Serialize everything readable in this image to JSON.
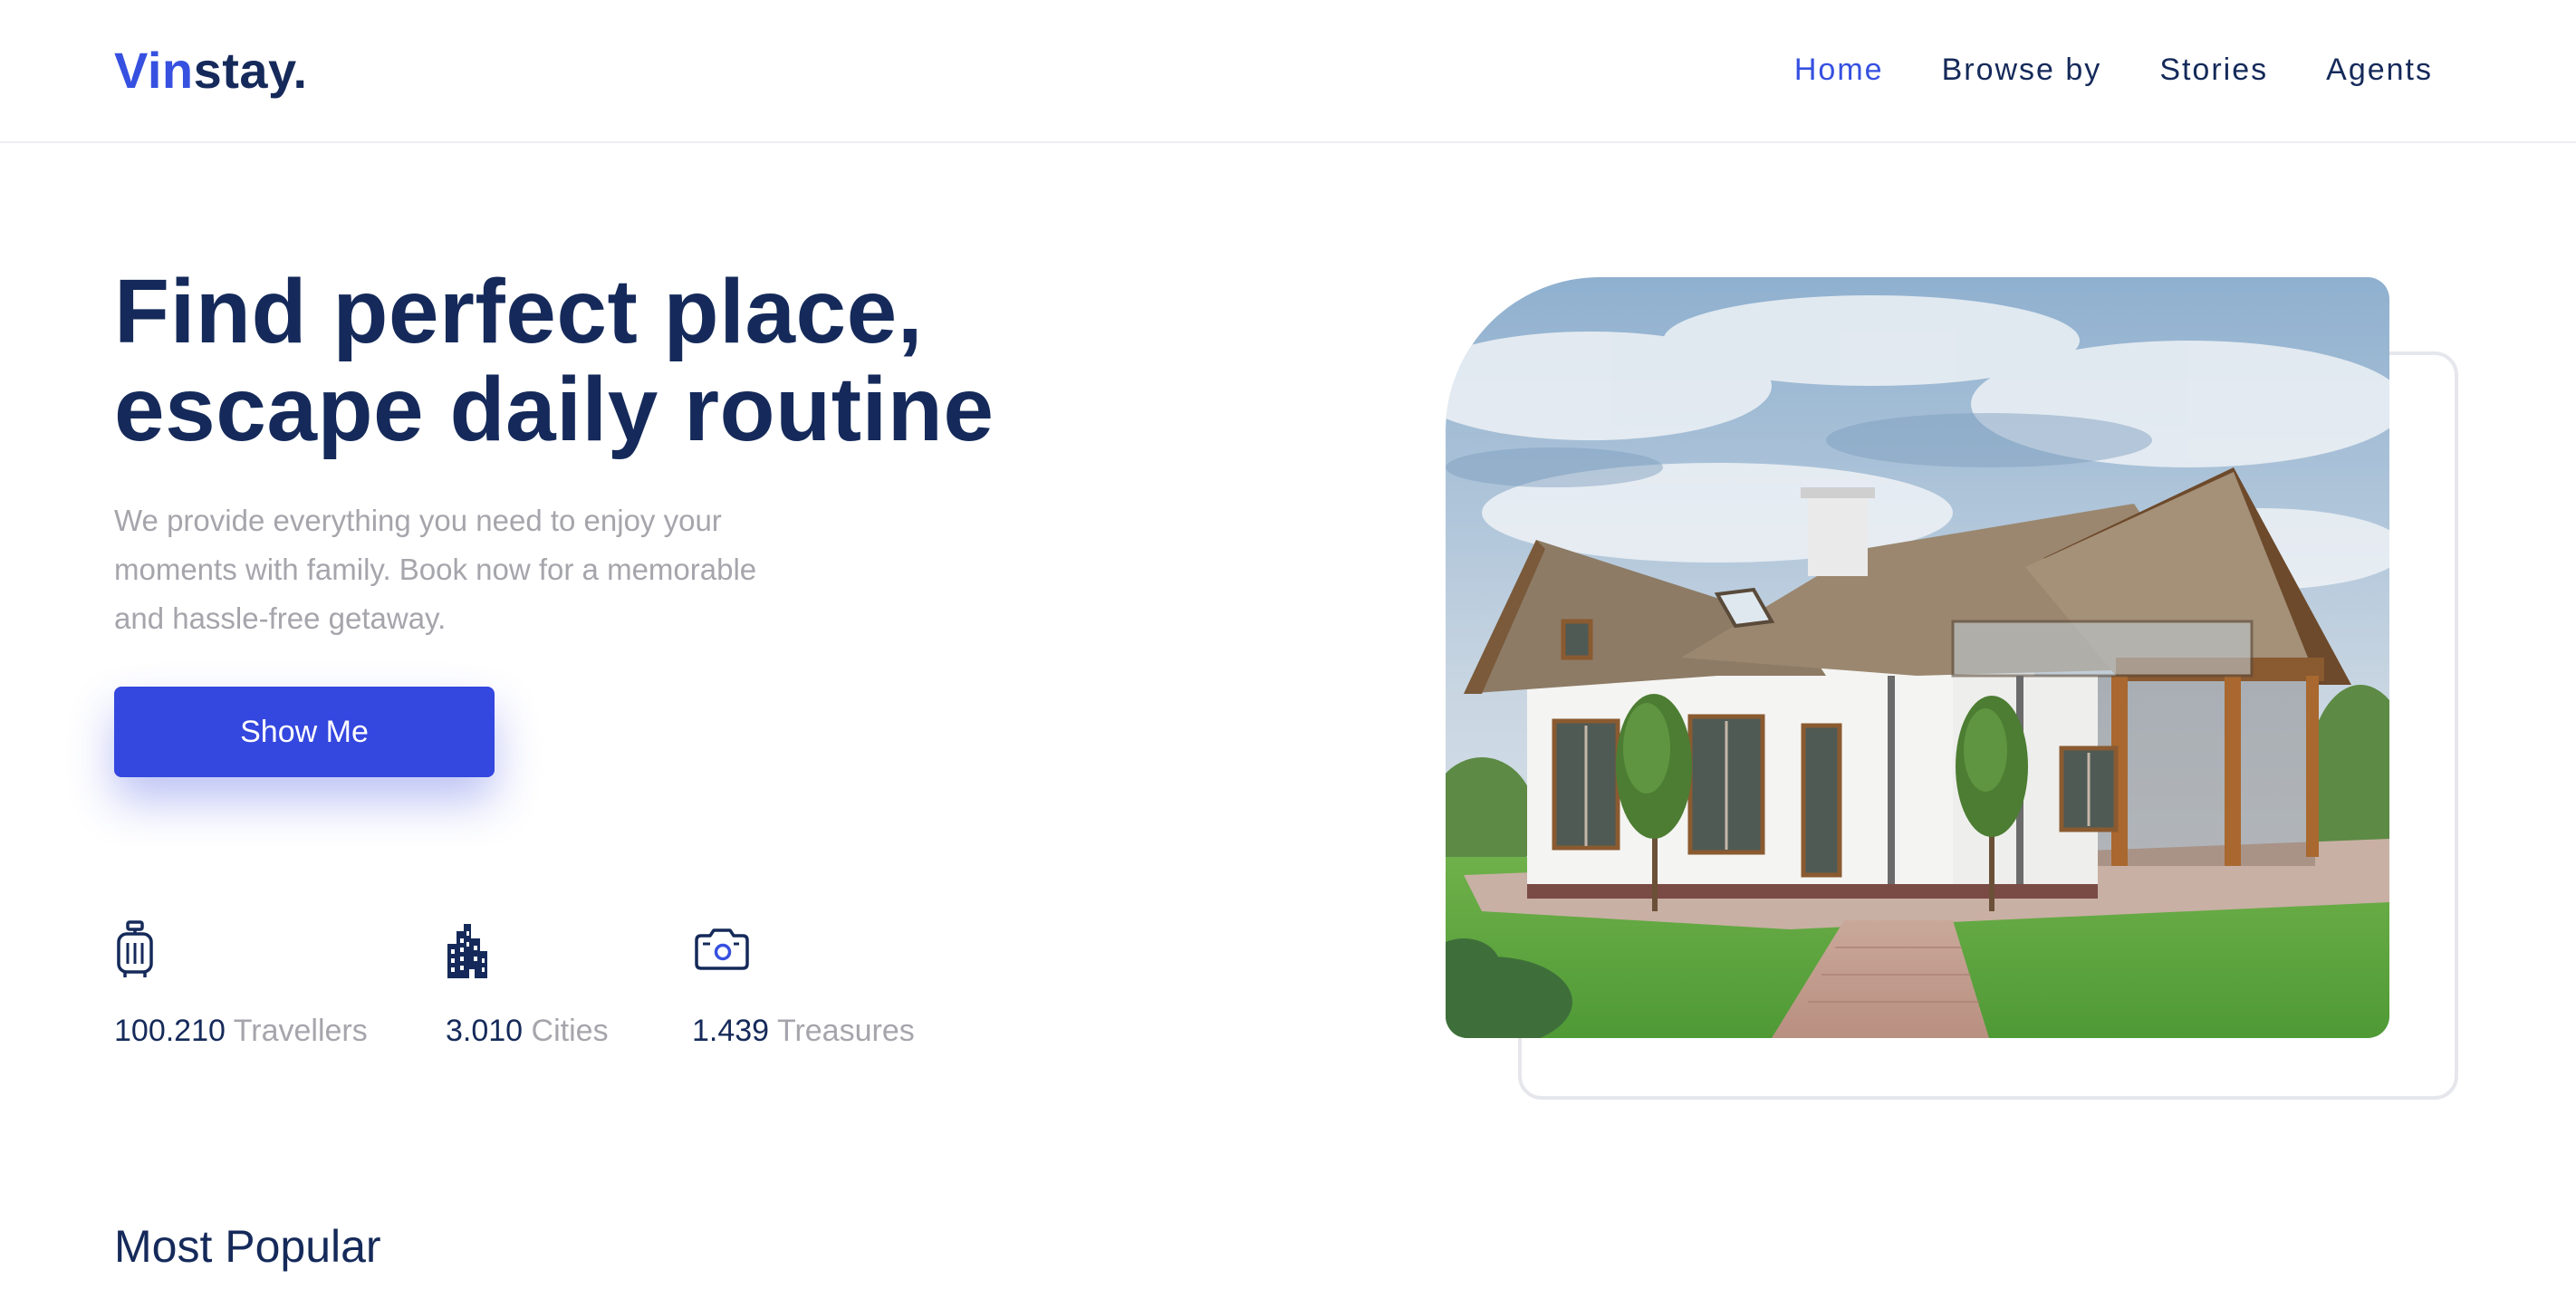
{
  "brand": {
    "accent_part": "Vin",
    "rest_part": "stay.",
    "accent_color": "#3650e0",
    "text_color": "#152a5a"
  },
  "nav": {
    "items": [
      {
        "label": "Home",
        "active": true
      },
      {
        "label": "Browse by",
        "active": false
      },
      {
        "label": "Stories",
        "active": false
      },
      {
        "label": "Agents",
        "active": false
      }
    ]
  },
  "hero": {
    "title_line1": "Find perfect place,",
    "title_line2": "escape daily routine",
    "description": "We provide everything you need to enjoy your moments with family. Book now for a memorable and hassle-free getaway.",
    "cta_label": "Show Me",
    "image_icon": "house-photo"
  },
  "stats": [
    {
      "icon": "suitcase-icon",
      "value": "100.210",
      "label": "Travellers"
    },
    {
      "icon": "city-buildings-icon",
      "value": "3.010",
      "label": "Cities"
    },
    {
      "icon": "camera-icon",
      "value": "1.439",
      "label": "Treasures"
    }
  ],
  "sections": {
    "most_popular_title": "Most Popular"
  }
}
